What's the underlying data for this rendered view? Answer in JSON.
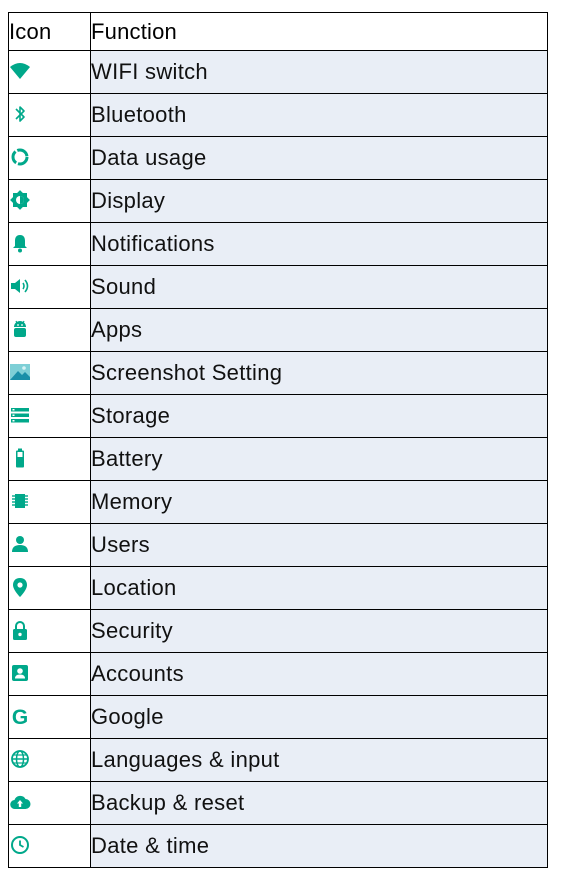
{
  "header": {
    "icon_col": "Icon",
    "function_col": "Function"
  },
  "accent": "#00a88a",
  "rows": [
    {
      "icon": "wifi-icon",
      "label": "WIFI switch"
    },
    {
      "icon": "bluetooth-icon",
      "label": "Bluetooth"
    },
    {
      "icon": "data-usage-icon",
      "label": "Data usage"
    },
    {
      "icon": "brightness-icon",
      "label": "Display"
    },
    {
      "icon": "bell-icon",
      "label": "Notifications"
    },
    {
      "icon": "volume-icon",
      "label": "Sound"
    },
    {
      "icon": "android-icon",
      "label": "Apps"
    },
    {
      "icon": "screenshot-image-icon",
      "label": "Screenshot Setting"
    },
    {
      "icon": "storage-icon",
      "label": "Storage"
    },
    {
      "icon": "battery-icon",
      "label": "Battery"
    },
    {
      "icon": "memory-chip-icon",
      "label": "Memory"
    },
    {
      "icon": "person-icon",
      "label": "Users"
    },
    {
      "icon": "location-pin-icon",
      "label": "Location"
    },
    {
      "icon": "lock-icon",
      "label": "Security"
    },
    {
      "icon": "account-box-icon",
      "label": "Accounts"
    },
    {
      "icon": "google-g-icon",
      "label": "Google"
    },
    {
      "icon": "globe-icon",
      "label": "Languages & input"
    },
    {
      "icon": "cloud-upload-icon",
      "label": "Backup & reset"
    },
    {
      "icon": "clock-icon",
      "label": "Date & time"
    }
  ]
}
